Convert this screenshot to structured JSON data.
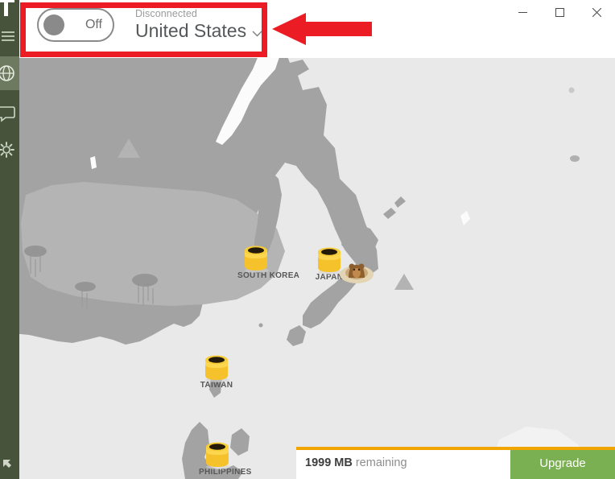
{
  "window": {
    "controls": [
      {
        "name": "minimize",
        "label": "Minimize"
      },
      {
        "name": "maximize",
        "label": "Maximize"
      },
      {
        "name": "close",
        "label": "Close"
      }
    ]
  },
  "sidebar": {
    "logo": "app-logo",
    "menu_label": "Menu",
    "items": [
      {
        "icon": "globe-icon",
        "label": "Locations",
        "active": true
      },
      {
        "icon": "chat-icon",
        "label": "Support",
        "active": false
      },
      {
        "icon": "gear-icon",
        "label": "Settings",
        "active": false
      }
    ],
    "resize_label": "Expand"
  },
  "header": {
    "toggle": {
      "state_label": "Off",
      "is_on": false
    },
    "status": "Disconnected",
    "country": "United States",
    "caret": "⌄"
  },
  "map": {
    "markers": [
      {
        "id": "korea",
        "label": "SOUTH KOREA"
      },
      {
        "id": "japan",
        "label": "JAPAN"
      },
      {
        "id": "taiwan",
        "label": "TAIWAN"
      },
      {
        "id": "philippines",
        "label": "PHILIPPINES"
      }
    ],
    "colors": {
      "water": "#e9e9e9",
      "land": "#a3a3a3",
      "land_light": "#b4b4b4"
    }
  },
  "databar": {
    "amount": "1999 MB",
    "remaining_label": "remaining",
    "upgrade_label": "Upgrade",
    "progress_percent": 100,
    "progress_color": "#f0a500",
    "upgrade_color": "#7bb052"
  },
  "annotations": {
    "highlight_color": "#ec1c24",
    "rect_target": "vpn-toggle-and-country-selector",
    "arrow_direction": "left"
  }
}
